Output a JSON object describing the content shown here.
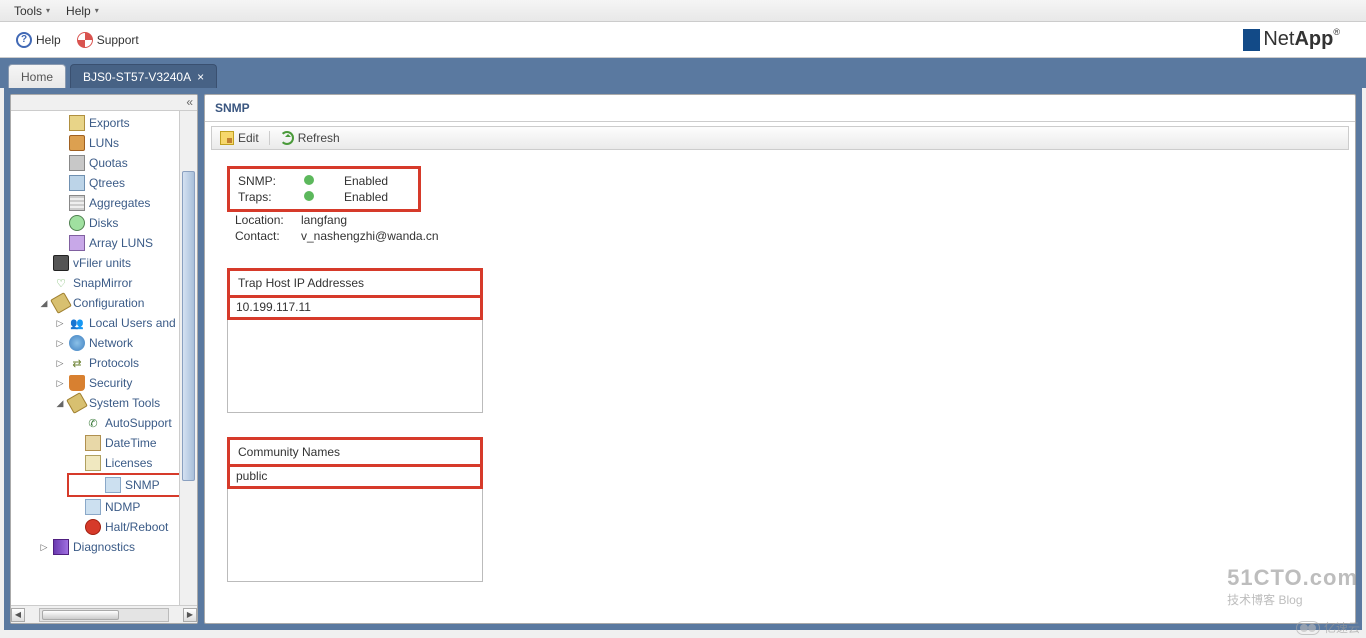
{
  "menubar": {
    "tools": "Tools",
    "help": "Help"
  },
  "toolbar": {
    "help": "Help",
    "support": "Support",
    "brand_a": "Net",
    "brand_b": "App"
  },
  "tabs": {
    "home": "Home",
    "active": "BJS0-ST57-V3240A"
  },
  "sidebar": {
    "items": [
      {
        "label": "Exports"
      },
      {
        "label": "LUNs"
      },
      {
        "label": "Quotas"
      },
      {
        "label": "Qtrees"
      },
      {
        "label": "Aggregates"
      },
      {
        "label": "Disks"
      },
      {
        "label": "Array LUNS"
      },
      {
        "label": "vFiler units"
      },
      {
        "label": "SnapMirror"
      },
      {
        "label": "Configuration"
      },
      {
        "label": "Local Users and"
      },
      {
        "label": "Network"
      },
      {
        "label": "Protocols"
      },
      {
        "label": "Security"
      },
      {
        "label": "System Tools"
      },
      {
        "label": "AutoSupport"
      },
      {
        "label": "DateTime"
      },
      {
        "label": "Licenses"
      },
      {
        "label": "SNMP"
      },
      {
        "label": "NDMP"
      },
      {
        "label": "Halt/Reboot"
      },
      {
        "label": "Diagnostics"
      }
    ]
  },
  "content": {
    "title": "SNMP",
    "toolbar": {
      "edit": "Edit",
      "refresh": "Refresh"
    },
    "info": {
      "snmp_label": "SNMP:",
      "snmp_value": "Enabled",
      "traps_label": "Traps:",
      "traps_value": "Enabled",
      "location_label": "Location:",
      "location_value": "langfang",
      "contact_label": "Contact:",
      "contact_value": "v_nashengzhi@wanda.cn"
    },
    "trap_hosts": {
      "title": "Trap Host IP Addresses",
      "items": [
        "10.199.117.11"
      ]
    },
    "community": {
      "title": "Community Names",
      "items": [
        "public"
      ]
    }
  },
  "watermark": {
    "l1": "51CTO.com",
    "l2": "技术博客   Blog",
    "yisu": "亿速云"
  }
}
